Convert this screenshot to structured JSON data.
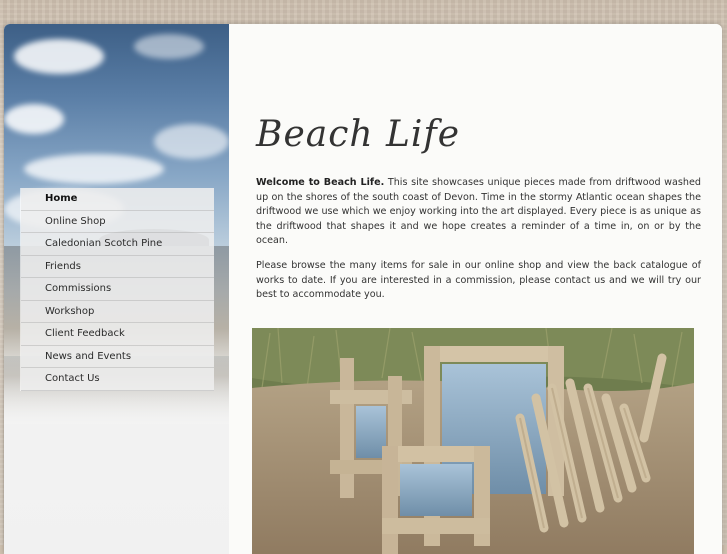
{
  "site": {
    "title": "Beach Life"
  },
  "nav": {
    "items": [
      {
        "label": "Home",
        "active": true
      },
      {
        "label": "Online Shop"
      },
      {
        "label": "Caledonian Scotch Pine"
      },
      {
        "label": "Friends"
      },
      {
        "label": "Commissions"
      },
      {
        "label": "Workshop"
      },
      {
        "label": "Client Feedback"
      },
      {
        "label": "News and Events"
      },
      {
        "label": "Contact Us"
      }
    ]
  },
  "content": {
    "intro_bold": "Welcome to Beach Life.",
    "intro_text": " This site showcases unique pieces made from driftwood washed up on the shores of the south coast of Devon. Time in the stormy Atlantic ocean shapes the driftwood we use which we enjoy working into the art displayed. Every piece is as unique as the driftwood that shapes it and we hope creates a reminder of a time in, on or by the ocean.",
    "para2": "Please browse the many items for sale in our online shop and view the back catalogue of works to date. If you are interested in a commission, please contact us and we will try our best to accommodate you."
  },
  "colors": {
    "page_bg": "#fbfbf9",
    "nav_bg": "#eeeeee",
    "text": "#333333",
    "sky_top": "#3d5f86"
  }
}
